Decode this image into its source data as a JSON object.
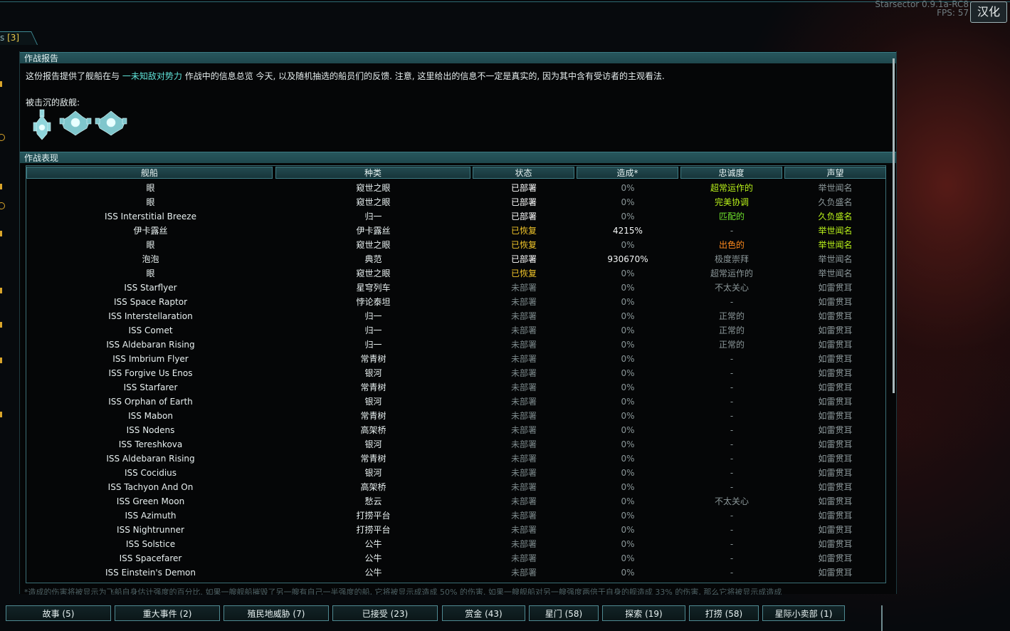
{
  "window": {
    "top_right_text": "Starsector 0.9.1a-RC8",
    "fps_text": "FPS: 57",
    "corner_button_label": "汉化",
    "tab_label_prefix": "s",
    "tab_count": "[3]"
  },
  "report": {
    "section_title": "作战报告",
    "intro_before": "这份报告提供了舰船在与",
    "intro_faction": "一未知敌对势力",
    "intro_after": "作战中的信息总览 今天, 以及随机抽选的船员们的反馈. 注意, 这里给出的信息不一定是真实的, 因为其中含有受访者的主观看法.",
    "sunk_label": "被击沉的敌舰:"
  },
  "performance": {
    "section_title": "作战表现",
    "columns": [
      "舰船",
      "种类",
      "状态",
      "造成*",
      "忠诚度",
      "声望"
    ],
    "rows": [
      {
        "ship": "眼",
        "type": "窥世之眼",
        "status": "已部署",
        "status_kind": "deployed",
        "damage": "0%",
        "loyalty": "超常运作的",
        "loyalty_kind": "good",
        "rep": "举世闻名",
        "rep_kind": "normal"
      },
      {
        "ship": "眼",
        "type": "窥世之眼",
        "status": "已部署",
        "status_kind": "deployed",
        "damage": "0%",
        "loyalty": "完美协调",
        "loyalty_kind": "good",
        "rep": "久负盛名",
        "rep_kind": "normal"
      },
      {
        "ship": "ISS Interstitial Breeze",
        "type": "归一",
        "status": "已部署",
        "status_kind": "deployed",
        "damage": "0%",
        "loyalty": "匹配的",
        "loyalty_kind": "match",
        "rep": "久负盛名",
        "rep_kind": "fame"
      },
      {
        "ship": "伊卡露丝",
        "type": "伊卡露丝",
        "status": "已恢复",
        "status_kind": "recovered",
        "damage": "4215%",
        "damage_hi": true,
        "loyalty": "-",
        "loyalty_kind": "normal",
        "rep": "举世闻名",
        "rep_kind": "fame"
      },
      {
        "ship": "眼",
        "type": "窥世之眼",
        "status": "已恢复",
        "status_kind": "recovered",
        "damage": "0%",
        "loyalty": "出色的",
        "loyalty_kind": "excellent",
        "rep": "举世闻名",
        "rep_kind": "fame"
      },
      {
        "ship": "泡泡",
        "type": "典范",
        "status": "已部署",
        "status_kind": "deployed",
        "damage": "930670%",
        "damage_hi": true,
        "loyalty": "极度崇拜",
        "loyalty_kind": "normal",
        "rep": "举世闻名",
        "rep_kind": "normal"
      },
      {
        "ship": "眼",
        "type": "窥世之眼",
        "status": "已恢复",
        "status_kind": "recovered",
        "damage": "0%",
        "loyalty": "超常运作的",
        "loyalty_kind": "normal",
        "rep": "举世闻名",
        "rep_kind": "normal"
      },
      {
        "ship": "ISS Starflyer",
        "type": "星穹列车",
        "status": "未部署",
        "status_kind": "none",
        "damage": "0%",
        "loyalty": "不太关心",
        "loyalty_kind": "normal",
        "rep": "如雷贯耳",
        "rep_kind": "normal"
      },
      {
        "ship": "ISS Space Raptor",
        "type": "悖论泰坦",
        "status": "未部署",
        "status_kind": "none",
        "damage": "0%",
        "loyalty": "-",
        "loyalty_kind": "normal",
        "rep": "如雷贯耳",
        "rep_kind": "normal"
      },
      {
        "ship": "ISS Interstellaration",
        "type": "归一",
        "status": "未部署",
        "status_kind": "none",
        "damage": "0%",
        "loyalty": "正常的",
        "loyalty_kind": "normal",
        "rep": "如雷贯耳",
        "rep_kind": "normal"
      },
      {
        "ship": "ISS Comet",
        "type": "归一",
        "status": "未部署",
        "status_kind": "none",
        "damage": "0%",
        "loyalty": "正常的",
        "loyalty_kind": "normal",
        "rep": "如雷贯耳",
        "rep_kind": "normal"
      },
      {
        "ship": "ISS Aldebaran Rising",
        "type": "归一",
        "status": "未部署",
        "status_kind": "none",
        "damage": "0%",
        "loyalty": "正常的",
        "loyalty_kind": "normal",
        "rep": "如雷贯耳",
        "rep_kind": "normal"
      },
      {
        "ship": "ISS Imbrium Flyer",
        "type": "常青树",
        "status": "未部署",
        "status_kind": "none",
        "damage": "0%",
        "loyalty": "-",
        "loyalty_kind": "normal",
        "rep": "如雷贯耳",
        "rep_kind": "normal"
      },
      {
        "ship": "ISS Forgive Us Enos",
        "type": "银河",
        "status": "未部署",
        "status_kind": "none",
        "damage": "0%",
        "loyalty": "-",
        "loyalty_kind": "normal",
        "rep": "如雷贯耳",
        "rep_kind": "normal"
      },
      {
        "ship": "ISS Starfarer",
        "type": "常青树",
        "status": "未部署",
        "status_kind": "none",
        "damage": "0%",
        "loyalty": "-",
        "loyalty_kind": "normal",
        "rep": "如雷贯耳",
        "rep_kind": "normal"
      },
      {
        "ship": "ISS Orphan of Earth",
        "type": "银河",
        "status": "未部署",
        "status_kind": "none",
        "damage": "0%",
        "loyalty": "-",
        "loyalty_kind": "normal",
        "rep": "如雷贯耳",
        "rep_kind": "normal"
      },
      {
        "ship": "ISS Mabon",
        "type": "常青树",
        "status": "未部署",
        "status_kind": "none",
        "damage": "0%",
        "loyalty": "-",
        "loyalty_kind": "normal",
        "rep": "如雷贯耳",
        "rep_kind": "normal"
      },
      {
        "ship": "ISS Nodens",
        "type": "高架桥",
        "status": "未部署",
        "status_kind": "none",
        "damage": "0%",
        "loyalty": "-",
        "loyalty_kind": "normal",
        "rep": "如雷贯耳",
        "rep_kind": "normal"
      },
      {
        "ship": "ISS Tereshkova",
        "type": "银河",
        "status": "未部署",
        "status_kind": "none",
        "damage": "0%",
        "loyalty": "-",
        "loyalty_kind": "normal",
        "rep": "如雷贯耳",
        "rep_kind": "normal"
      },
      {
        "ship": "ISS Aldebaran Rising",
        "type": "常青树",
        "status": "未部署",
        "status_kind": "none",
        "damage": "0%",
        "loyalty": "-",
        "loyalty_kind": "normal",
        "rep": "如雷贯耳",
        "rep_kind": "normal"
      },
      {
        "ship": "ISS Cocidius",
        "type": "银河",
        "status": "未部署",
        "status_kind": "none",
        "damage": "0%",
        "loyalty": "-",
        "loyalty_kind": "normal",
        "rep": "如雷贯耳",
        "rep_kind": "normal"
      },
      {
        "ship": "ISS Tachyon And On",
        "type": "高架桥",
        "status": "未部署",
        "status_kind": "none",
        "damage": "0%",
        "loyalty": "-",
        "loyalty_kind": "normal",
        "rep": "如雷贯耳",
        "rep_kind": "normal"
      },
      {
        "ship": "ISS Green Moon",
        "type": "愁云",
        "status": "未部署",
        "status_kind": "none",
        "damage": "0%",
        "loyalty": "不太关心",
        "loyalty_kind": "normal",
        "rep": "如雷贯耳",
        "rep_kind": "normal"
      },
      {
        "ship": "ISS Azimuth",
        "type": "打捞平台",
        "status": "未部署",
        "status_kind": "none",
        "damage": "0%",
        "loyalty": "-",
        "loyalty_kind": "normal",
        "rep": "如雷贯耳",
        "rep_kind": "normal"
      },
      {
        "ship": "ISS Nightrunner",
        "type": "打捞平台",
        "status": "未部署",
        "status_kind": "none",
        "damage": "0%",
        "loyalty": "-",
        "loyalty_kind": "normal",
        "rep": "如雷贯耳",
        "rep_kind": "normal"
      },
      {
        "ship": "ISS Solstice",
        "type": "公牛",
        "status": "未部署",
        "status_kind": "none",
        "damage": "0%",
        "loyalty": "-",
        "loyalty_kind": "normal",
        "rep": "如雷贯耳",
        "rep_kind": "normal"
      },
      {
        "ship": "ISS Spacefarer",
        "type": "公牛",
        "status": "未部署",
        "status_kind": "none",
        "damage": "0%",
        "loyalty": "-",
        "loyalty_kind": "normal",
        "rep": "如雷贯耳",
        "rep_kind": "normal"
      },
      {
        "ship": "ISS Einstein's Demon",
        "type": "公牛",
        "status": "未部署",
        "status_kind": "none",
        "damage": "0%",
        "loyalty": "-",
        "loyalty_kind": "normal",
        "rep": "如雷贯耳",
        "rep_kind": "normal"
      }
    ],
    "footnote": "*造成的伤害将被显示为飞船自身估计强度的百分比. 如果一艘舰船摧毁了另一艘有自己一半强度的船, 它将被显示成造成 50% 的伤害. 如果一艘舰船对另一艘强度两倍于自身的舰造成 33% 的伤害, 那么它将被显示成造成"
  },
  "bottom_tabs": [
    {
      "label": "故事 (5)"
    },
    {
      "label": "重大事件 (2)"
    },
    {
      "label": "殖民地威胁 (7)"
    },
    {
      "label": "已接受 (23)"
    },
    {
      "label": "赏金 (43)"
    },
    {
      "label": "星门 (58)"
    },
    {
      "label": "探索 (19)"
    },
    {
      "label": "打捞 (58)"
    },
    {
      "label": "星际小卖部 (1)"
    }
  ],
  "colors": {
    "accent": "#5fe3d8",
    "header_bg": "#1f484d",
    "recovered": "#f2c62a",
    "good": "#b9f21a",
    "excellent": "#ff8a1c"
  }
}
